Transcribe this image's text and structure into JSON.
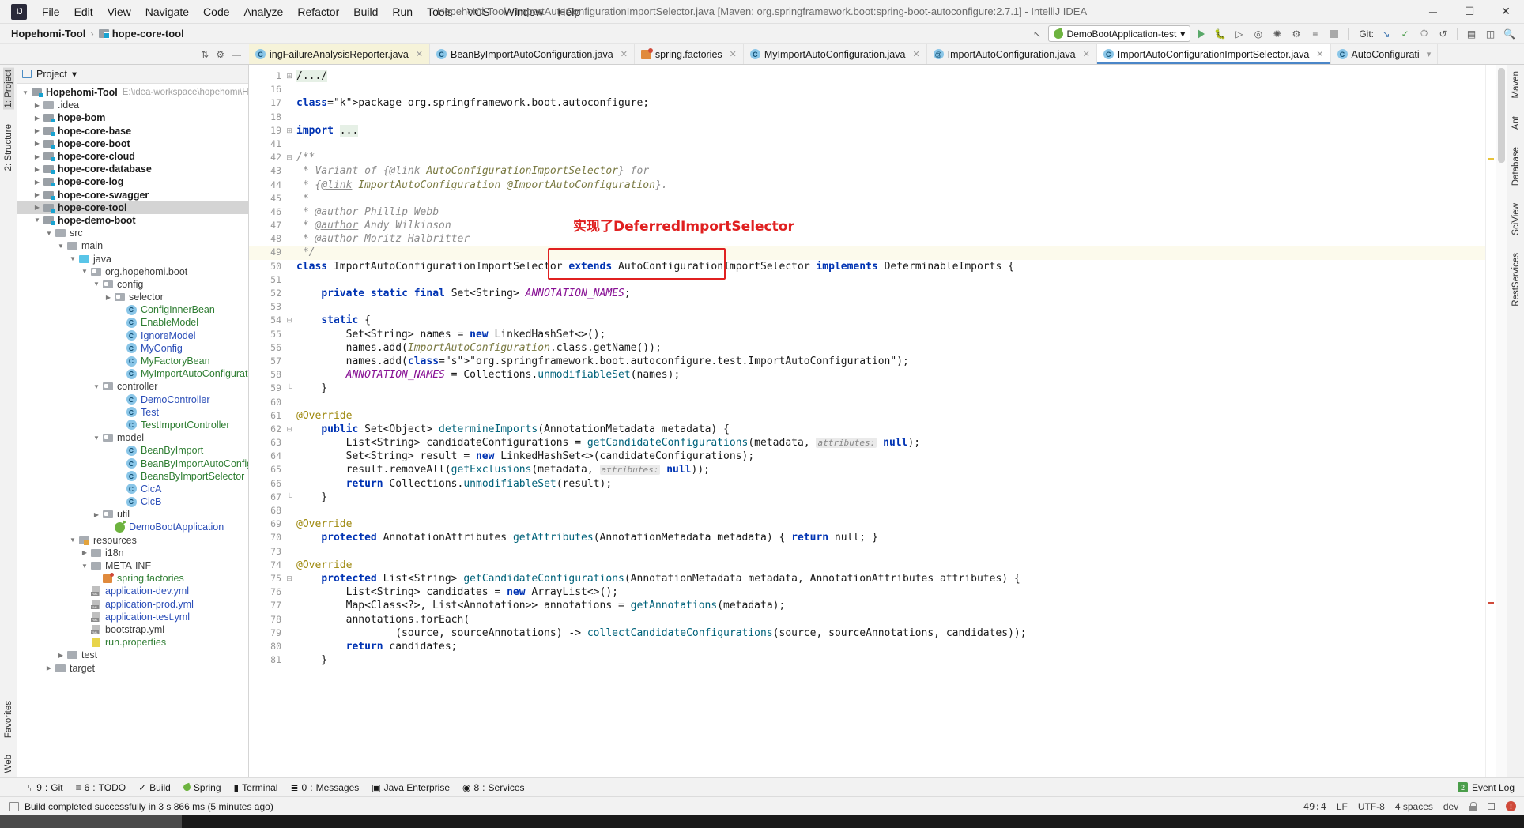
{
  "window": {
    "title": "Hopehomi-Tool - ImportAutoConfigurationImportSelector.java [Maven: org.springframework.boot:spring-boot-autoconfigure:2.7.1] - IntelliJ IDEA",
    "logo": "IJ",
    "minimize": "─",
    "maximize": "☐",
    "close": "✕"
  },
  "menu": {
    "items": [
      "File",
      "Edit",
      "View",
      "Navigate",
      "Code",
      "Analyze",
      "Refactor",
      "Build",
      "Run",
      "Tools",
      "VCS",
      "Window",
      "Help"
    ]
  },
  "navbar": {
    "breadcrumb": [
      "Hopehomi-Tool",
      "hope-core-tool"
    ],
    "separator": "›",
    "run_config": "DemoBootApplication-test",
    "dropdown_caret": "▾",
    "git_label": "Git:",
    "icons": {
      "back_arrow": "back-arrow-icon",
      "run": "run-icon",
      "debug": "debug-icon",
      "run_coverage": "run-with-coverage-icon",
      "profile": "profiler-icon",
      "attach": "attach-debugger-icon",
      "build": "build-icon",
      "rerun": "rerun-icon",
      "stop": "stop-icon",
      "update_project": "update-project-icon",
      "commit": "commit-icon",
      "history": "history-icon",
      "rollback": "rollback-icon",
      "structure": "structure-icon",
      "preview": "preview-icon",
      "search": "search-everywhere-icon"
    }
  },
  "tabs": [
    {
      "label": "ingFailureAnalysisReporter.java",
      "icon": "class-icon",
      "state": "yellowed",
      "close": "✕"
    },
    {
      "label": "BeanByImportAutoConfiguration.java",
      "icon": "class-icon",
      "state": "normal",
      "close": "✕"
    },
    {
      "label": "spring.factories",
      "icon": "factories-icon",
      "state": "normal",
      "close": "✕"
    },
    {
      "label": "MyImportAutoConfiguration.java",
      "icon": "class-icon",
      "state": "normal",
      "close": "✕"
    },
    {
      "label": "ImportAutoConfiguration.java",
      "icon": "annotation-icon",
      "state": "normal",
      "close": "✕"
    },
    {
      "label": "ImportAutoConfigurationImportSelector.java",
      "icon": "class-icon",
      "state": "active",
      "close": "✕"
    },
    {
      "label": "AutoConfigurati",
      "icon": "class-icon",
      "state": "normal",
      "close": ""
    }
  ],
  "left_rail": {
    "top": [
      "1: Project",
      "2: Structure",
      "Favorites"
    ],
    "bottom": [
      "Web"
    ]
  },
  "right_rail": [
    "Maven",
    "Ant",
    "Database",
    "SciView",
    "RestServices"
  ],
  "project_panel": {
    "title": "Project",
    "caret": "▾",
    "tree": [
      {
        "depth": 0,
        "arrow": "d",
        "icon": "module-icon",
        "label": "Hopehomi-Tool",
        "style": "bold",
        "hint": "E:\\idea-workspace\\hopehomi\\Hope"
      },
      {
        "depth": 1,
        "arrow": "r",
        "icon": "folder-icon",
        "label": ".idea",
        "style": "grey",
        "hint": ""
      },
      {
        "depth": 1,
        "arrow": "r",
        "icon": "module-icon",
        "label": "hope-bom",
        "style": "bold",
        "hint": ""
      },
      {
        "depth": 1,
        "arrow": "r",
        "icon": "module-icon",
        "label": "hope-core-base",
        "style": "bold",
        "hint": ""
      },
      {
        "depth": 1,
        "arrow": "r",
        "icon": "module-icon",
        "label": "hope-core-boot",
        "style": "bold",
        "hint": ""
      },
      {
        "depth": 1,
        "arrow": "r",
        "icon": "module-icon",
        "label": "hope-core-cloud",
        "style": "bold",
        "hint": ""
      },
      {
        "depth": 1,
        "arrow": "r",
        "icon": "module-icon",
        "label": "hope-core-database",
        "style": "bold",
        "hint": ""
      },
      {
        "depth": 1,
        "arrow": "r",
        "icon": "module-icon",
        "label": "hope-core-log",
        "style": "bold",
        "hint": ""
      },
      {
        "depth": 1,
        "arrow": "r",
        "icon": "module-icon",
        "label": "hope-core-swagger",
        "style": "bold",
        "hint": ""
      },
      {
        "depth": 1,
        "arrow": "r",
        "icon": "module-icon",
        "label": "hope-core-tool",
        "style": "bold",
        "hint": "",
        "selected": true
      },
      {
        "depth": 1,
        "arrow": "d",
        "icon": "module-icon",
        "label": "hope-demo-boot",
        "style": "bold",
        "hint": ""
      },
      {
        "depth": 2,
        "arrow": "d",
        "icon": "folder-icon",
        "label": "src",
        "style": "grey",
        "hint": ""
      },
      {
        "depth": 3,
        "arrow": "d",
        "icon": "folder-icon",
        "label": "main",
        "style": "grey",
        "hint": ""
      },
      {
        "depth": 4,
        "arrow": "d",
        "icon": "source-folder-icon",
        "label": "java",
        "style": "grey",
        "hint": ""
      },
      {
        "depth": 5,
        "arrow": "d",
        "icon": "package-icon",
        "label": "org.hopehomi.boot",
        "style": "grey",
        "hint": ""
      },
      {
        "depth": 6,
        "arrow": "d",
        "icon": "package-icon",
        "label": "config",
        "style": "grey",
        "hint": ""
      },
      {
        "depth": 7,
        "arrow": "r",
        "icon": "package-icon",
        "label": "selector",
        "style": "grey",
        "hint": ""
      },
      {
        "depth": 8,
        "arrow": "none",
        "icon": "class-icon",
        "label": "ConfigInnerBean",
        "style": "green",
        "hint": ""
      },
      {
        "depth": 8,
        "arrow": "none",
        "icon": "class-icon",
        "label": "EnableModel",
        "style": "green",
        "hint": ""
      },
      {
        "depth": 8,
        "arrow": "none",
        "icon": "class-icon",
        "label": "IgnoreModel",
        "style": "blue",
        "hint": ""
      },
      {
        "depth": 8,
        "arrow": "none",
        "icon": "class-icon",
        "label": "MyConfig",
        "style": "blue",
        "hint": ""
      },
      {
        "depth": 8,
        "arrow": "none",
        "icon": "class-icon",
        "label": "MyFactoryBean",
        "style": "green",
        "hint": ""
      },
      {
        "depth": 8,
        "arrow": "none",
        "icon": "class-icon",
        "label": "MyImportAutoConfiguration",
        "style": "green",
        "hint": ""
      },
      {
        "depth": 6,
        "arrow": "d",
        "icon": "package-icon",
        "label": "controller",
        "style": "grey",
        "hint": ""
      },
      {
        "depth": 8,
        "arrow": "none",
        "icon": "class-icon",
        "label": "DemoController",
        "style": "blue",
        "hint": ""
      },
      {
        "depth": 8,
        "arrow": "none",
        "icon": "class-icon",
        "label": "Test",
        "style": "blue",
        "hint": ""
      },
      {
        "depth": 8,
        "arrow": "none",
        "icon": "class-icon",
        "label": "TestImportController",
        "style": "green",
        "hint": ""
      },
      {
        "depth": 6,
        "arrow": "d",
        "icon": "package-icon",
        "label": "model",
        "style": "grey",
        "hint": ""
      },
      {
        "depth": 8,
        "arrow": "none",
        "icon": "class-icon",
        "label": "BeanByImport",
        "style": "green",
        "hint": ""
      },
      {
        "depth": 8,
        "arrow": "none",
        "icon": "class-icon",
        "label": "BeanByImportAutoConfiguratio",
        "style": "green",
        "hint": ""
      },
      {
        "depth": 8,
        "arrow": "none",
        "icon": "class-icon",
        "label": "BeansByImportSelector",
        "style": "green",
        "hint": ""
      },
      {
        "depth": 8,
        "arrow": "none",
        "icon": "class-icon",
        "label": "CicA",
        "style": "blue",
        "hint": ""
      },
      {
        "depth": 8,
        "arrow": "none",
        "icon": "class-icon",
        "label": "CicB",
        "style": "blue",
        "hint": ""
      },
      {
        "depth": 6,
        "arrow": "r",
        "icon": "package-icon",
        "label": "util",
        "style": "grey",
        "hint": ""
      },
      {
        "depth": 7,
        "arrow": "none",
        "icon": "spring-boot-app-icon",
        "label": "DemoBootApplication",
        "style": "blue",
        "hint": ""
      },
      {
        "depth": 4,
        "arrow": "d",
        "icon": "resources-folder-icon",
        "label": "resources",
        "style": "grey",
        "hint": ""
      },
      {
        "depth": 5,
        "arrow": "r",
        "icon": "folder-icon",
        "label": "i18n",
        "style": "grey",
        "hint": ""
      },
      {
        "depth": 5,
        "arrow": "d",
        "icon": "folder-icon",
        "label": "META-INF",
        "style": "grey",
        "hint": ""
      },
      {
        "depth": 6,
        "arrow": "none",
        "icon": "factories-icon",
        "label": "spring.factories",
        "style": "green",
        "hint": ""
      },
      {
        "depth": 5,
        "arrow": "none",
        "icon": "yml-icon",
        "label": "application-dev.yml",
        "style": "blue",
        "hint": ""
      },
      {
        "depth": 5,
        "arrow": "none",
        "icon": "yml-icon",
        "label": "application-prod.yml",
        "style": "blue",
        "hint": ""
      },
      {
        "depth": 5,
        "arrow": "none",
        "icon": "yml-icon",
        "label": "application-test.yml",
        "style": "blue",
        "hint": ""
      },
      {
        "depth": 5,
        "arrow": "none",
        "icon": "yml-icon",
        "label": "bootstrap.yml",
        "style": "grey",
        "hint": ""
      },
      {
        "depth": 5,
        "arrow": "none",
        "icon": "properties-icon",
        "label": "run.properties",
        "style": "green",
        "hint": ""
      },
      {
        "depth": 3,
        "arrow": "r",
        "icon": "folder-icon",
        "label": "test",
        "style": "grey",
        "hint": ""
      },
      {
        "depth": 2,
        "arrow": "r",
        "icon": "folder-icon",
        "label": "target",
        "style": "grey",
        "hint": ""
      }
    ]
  },
  "editor": {
    "annotation": {
      "text": "实现了DeferredImportSelector",
      "color": "#e02020"
    },
    "lines": [
      {
        "num": "1",
        "text": "/.../",
        "fold": "plus"
      },
      {
        "num": "16",
        "text": ""
      },
      {
        "num": "17",
        "text": "package org.springframework.boot.autoconfigure;"
      },
      {
        "num": "18",
        "text": ""
      },
      {
        "num": "19",
        "text": "import ...",
        "fold": "plus"
      },
      {
        "num": "41",
        "text": ""
      },
      {
        "num": "42",
        "text": "/**",
        "fold": "minus"
      },
      {
        "num": "43",
        "text": " * Variant of {@link AutoConfigurationImportSelector} for"
      },
      {
        "num": "44",
        "text": " * {@link ImportAutoConfiguration @ImportAutoConfiguration}."
      },
      {
        "num": "45",
        "text": " *"
      },
      {
        "num": "46",
        "text": " * @author Phillip Webb"
      },
      {
        "num": "47",
        "text": " * @author Andy Wilkinson"
      },
      {
        "num": "48",
        "text": " * @author Moritz Halbritter"
      },
      {
        "num": "49",
        "text": " */",
        "current": true
      },
      {
        "num": "50",
        "text": "class ImportAutoConfigurationImportSelector extends AutoConfigurationImportSelector implements DeterminableImports {"
      },
      {
        "num": "51",
        "text": ""
      },
      {
        "num": "52",
        "text": "    private static final Set<String> ANNOTATION_NAMES;"
      },
      {
        "num": "53",
        "text": ""
      },
      {
        "num": "54",
        "text": "    static {",
        "fold": "minus"
      },
      {
        "num": "55",
        "text": "        Set<String> names = new LinkedHashSet<>();"
      },
      {
        "num": "56",
        "text": "        names.add(ImportAutoConfiguration.class.getName());"
      },
      {
        "num": "57",
        "text": "        names.add(\"org.springframework.boot.autoconfigure.test.ImportAutoConfiguration\");"
      },
      {
        "num": "58",
        "text": "        ANNOTATION_NAMES = Collections.unmodifiableSet(names);"
      },
      {
        "num": "59",
        "text": "    }",
        "fold": "end"
      },
      {
        "num": "60",
        "text": ""
      },
      {
        "num": "61",
        "text": "    @Override"
      },
      {
        "num": "62",
        "text": "    public Set<Object> determineImports(AnnotationMetadata metadata) {",
        "gutter_mark": "override",
        "fold": "minus"
      },
      {
        "num": "63",
        "text": "        List<String> candidateConfigurations = getCandidateConfigurations(metadata, attributes: null);"
      },
      {
        "num": "64",
        "text": "        Set<String> result = new LinkedHashSet<>(candidateConfigurations);"
      },
      {
        "num": "65",
        "text": "        result.removeAll(getExclusions(metadata, attributes: null));"
      },
      {
        "num": "66",
        "text": "        return Collections.unmodifiableSet(result);"
      },
      {
        "num": "67",
        "text": "    }",
        "fold": "end"
      },
      {
        "num": "68",
        "text": ""
      },
      {
        "num": "69",
        "text": "    @Override"
      },
      {
        "num": "70",
        "text": "    protected AnnotationAttributes getAttributes(AnnotationMetadata metadata) { return null; }",
        "gutter_mark": "override"
      },
      {
        "num": "73",
        "text": ""
      },
      {
        "num": "74",
        "text": "    @Override"
      },
      {
        "num": "75",
        "text": "    protected List<String> getCandidateConfigurations(AnnotationMetadata metadata, AnnotationAttributes attributes) {",
        "gutter_mark": "override",
        "fold": "minus"
      },
      {
        "num": "76",
        "text": "        List<String> candidates = new ArrayList<>();"
      },
      {
        "num": "77",
        "text": "        Map<Class<?>, List<Annotation>> annotations = getAnnotations(metadata);"
      },
      {
        "num": "78",
        "text": "        annotations.forEach("
      },
      {
        "num": "79",
        "text": "                (source, sourceAnnotations) -> collectCandidateConfigurations(source, sourceAnnotations, candidates));"
      },
      {
        "num": "80",
        "text": "        return candidates;"
      },
      {
        "num": "81",
        "text": "    }"
      }
    ]
  },
  "toolwindows": [
    {
      "num": "9",
      "label": "Git",
      "icon": "git-icon"
    },
    {
      "num": "6",
      "label": "TODO",
      "icon": "todo-icon"
    },
    {
      "num": "",
      "label": "Build",
      "icon": "build-icon"
    },
    {
      "num": "",
      "label": "Spring",
      "icon": "spring-icon"
    },
    {
      "num": "",
      "label": "Terminal",
      "icon": "terminal-icon"
    },
    {
      "num": "0",
      "label": "Messages",
      "icon": "messages-icon"
    },
    {
      "num": "",
      "label": "Java Enterprise",
      "icon": "java-enterprise-icon"
    },
    {
      "num": "8",
      "label": "Services",
      "icon": "services-icon"
    }
  ],
  "event_log": {
    "label": "Event Log",
    "badge": "2"
  },
  "statusbar": {
    "message": "Build completed successfully in 3 s 866 ms (5 minutes ago)",
    "caret": "49:4",
    "line_sep": "LF",
    "encoding": "UTF-8",
    "indent": "4 spaces",
    "branch": "dev",
    "error_count": ""
  }
}
